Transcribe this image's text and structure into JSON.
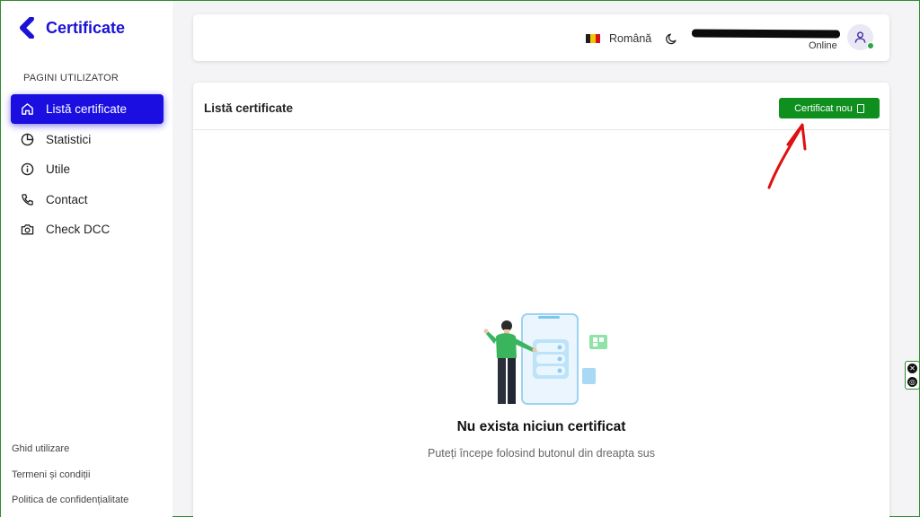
{
  "app": {
    "title": "Certificate"
  },
  "sidebar": {
    "section_header": "PAGINI UTILIZATOR",
    "items": [
      {
        "label": "Listă certificate",
        "icon": "home-icon",
        "active": true
      },
      {
        "label": "Statistici",
        "icon": "pie-chart-icon",
        "active": false
      },
      {
        "label": "Utile",
        "icon": "info-icon",
        "active": false
      },
      {
        "label": "Contact",
        "icon": "phone-icon",
        "active": false
      },
      {
        "label": "Check DCC",
        "icon": "camera-icon",
        "active": false
      }
    ],
    "footer_links": [
      "Ghid utilizare",
      "Termeni și condiții",
      "Politica de confidențialitate"
    ]
  },
  "topbar": {
    "language": "Română",
    "status": "Online"
  },
  "main": {
    "title": "Listă certificate",
    "new_button_label": "Certificat nou",
    "empty_title": "Nu exista niciun certificat",
    "empty_subtitle": "Puteți începe folosind butonul din dreapta sus"
  },
  "colors": {
    "brand": "#1a12d6",
    "active_nav": "#1a0fe0",
    "primary_button": "#0e8f1e",
    "annotation_arrow": "#e01010"
  }
}
